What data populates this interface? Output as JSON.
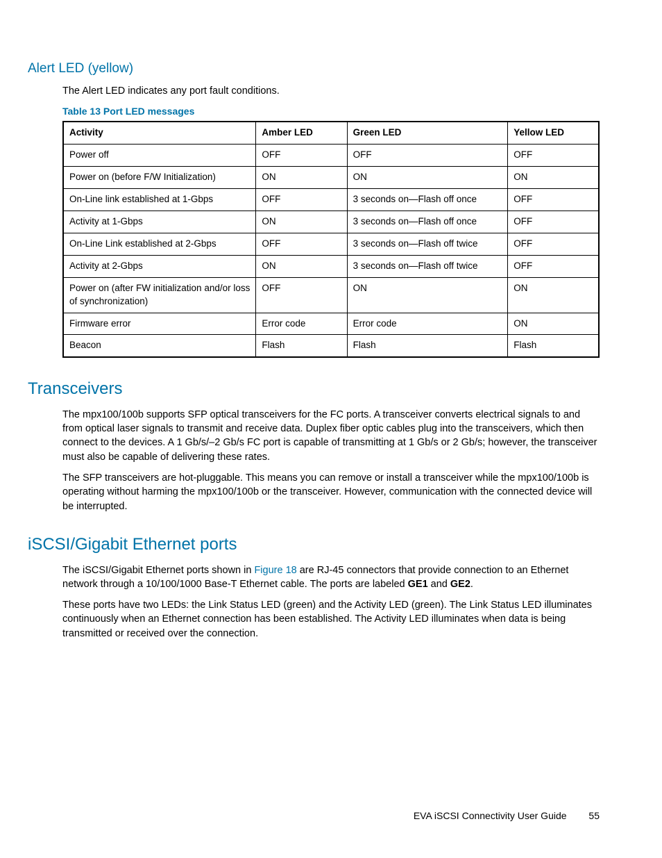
{
  "section1": {
    "heading": "Alert LED (yellow)",
    "para": "The Alert LED indicates any port fault conditions.",
    "tableCaption": "Table 13 Port LED messages",
    "headers": [
      "Activity",
      "Amber LED",
      "Green LED",
      "Yellow LED"
    ],
    "rows": [
      [
        "Power off",
        "OFF",
        "OFF",
        "OFF"
      ],
      [
        "Power on (before F/W Initialization)",
        "ON",
        "ON",
        "ON"
      ],
      [
        "On-Line link established at 1-Gbps",
        "OFF",
        "3 seconds on—Flash off once",
        "OFF"
      ],
      [
        "Activity at 1-Gbps",
        "ON",
        "3 seconds on—Flash off once",
        "OFF"
      ],
      [
        "On-Line Link established at 2-Gbps",
        "OFF",
        "3 seconds on—Flash off twice",
        "OFF"
      ],
      [
        "Activity at 2-Gbps",
        "ON",
        "3 seconds on—Flash off twice",
        "OFF"
      ],
      [
        "Power on (after FW initialization and/or loss of synchronization)",
        "OFF",
        "ON",
        "ON"
      ],
      [
        "Firmware error",
        "Error code",
        "Error code",
        "ON"
      ],
      [
        "Beacon",
        "Flash",
        "Flash",
        "Flash"
      ]
    ]
  },
  "section2": {
    "heading": "Transceivers",
    "para1": "The mpx100/100b supports SFP optical transceivers for the FC ports. A transceiver converts electrical signals to and from optical laser signals to transmit and receive data. Duplex fiber optic cables plug into the transceivers, which then connect to the devices. A 1 Gb/s/–2 Gb/s FC port is capable of transmitting at 1 Gb/s or 2 Gb/s; however, the transceiver must also be capable of delivering these rates.",
    "para2": "The SFP transceivers are hot-pluggable. This means you can remove or install a transceiver while the mpx100/100b is operating without harming the mpx100/100b or the transceiver. However, communication with the connected device will be interrupted."
  },
  "section3": {
    "heading": "iSCSI/Gigabit Ethernet ports",
    "para1_pre": "The iSCSI/Gigabit Ethernet ports shown in ",
    "para1_link": "Figure 18",
    "para1_mid": " are RJ-45 connectors that provide connection to an Ethernet network through a 10/100/1000 Base-T Ethernet cable. The ports are labeled ",
    "para1_b1": "GE1",
    "para1_and": " and ",
    "para1_b2": "GE2",
    "para1_end": ".",
    "para2": "These ports have two LEDs: the Link Status LED (green) and the Activity LED (green). The Link Status LED illuminates continuously when an Ethernet connection has been established. The Activity LED illuminates when data is being transmitted or received over the connection."
  },
  "footer": {
    "text": "EVA iSCSI Connectivity User Guide",
    "page": "55"
  }
}
